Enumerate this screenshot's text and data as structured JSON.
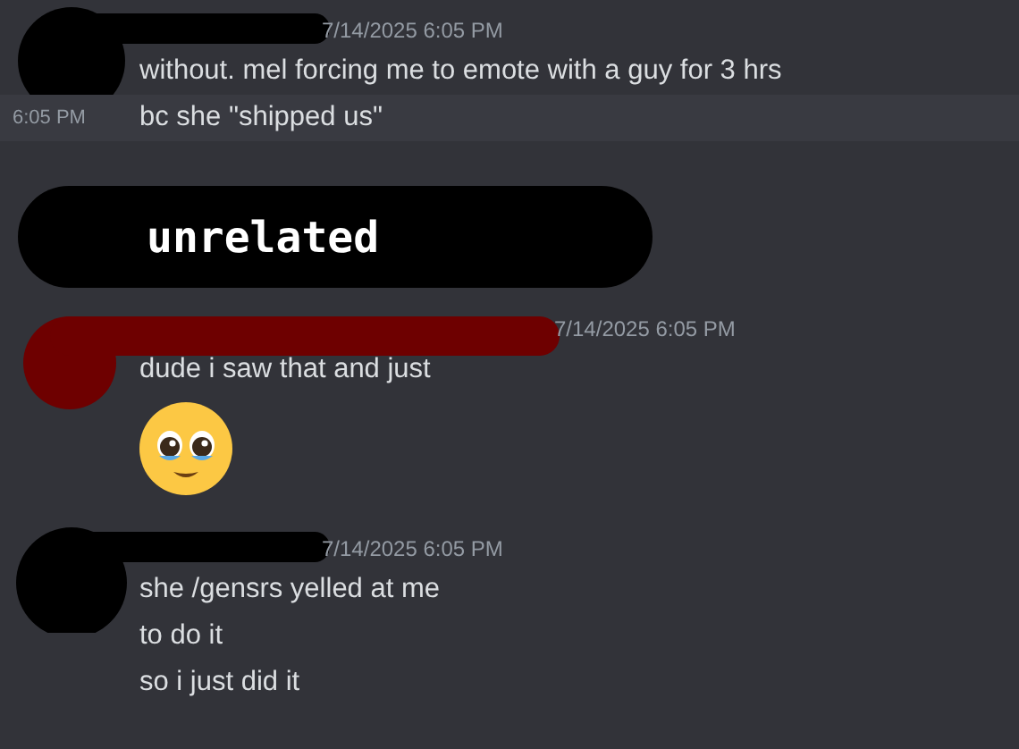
{
  "messages": [
    {
      "kind": "group",
      "color": "#000000",
      "timestamp": "7/14/2025 6:05 PM",
      "lines": [
        {
          "kind": "text",
          "text": "without. mel forcing me to emote with a guy for 3 hrs"
        },
        {
          "kind": "text",
          "text": "bc she \"shipped us\"",
          "hover_time": "6:05 PM"
        }
      ]
    },
    {
      "kind": "banner",
      "text": "unrelated"
    },
    {
      "kind": "group",
      "color": "#6e0000",
      "timestamp": "7/14/2025 6:05 PM",
      "lines": [
        {
          "kind": "text",
          "text": "dude i saw that and just"
        },
        {
          "kind": "emoji"
        }
      ]
    },
    {
      "kind": "group",
      "color": "#000000",
      "timestamp": "7/14/2025 6:05 PM",
      "lines": [
        {
          "kind": "text",
          "text": "she /gensrs yelled at me"
        },
        {
          "kind": "text",
          "text": "to do it"
        },
        {
          "kind": "text",
          "text": "so i just did it"
        }
      ]
    }
  ]
}
